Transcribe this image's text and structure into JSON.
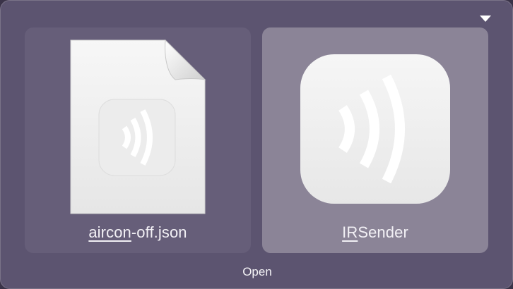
{
  "file_item": {
    "name_underlined": "aircon",
    "name_rest": "-off.json",
    "icon": "json-file-icon"
  },
  "app_item": {
    "name_underlined": "IR",
    "name_rest": "Sender",
    "icon": "irsender-app-icon",
    "selected": true
  },
  "open_button": {
    "label": "Open"
  },
  "options_menu": {
    "icon": "triangle-down-icon"
  },
  "colors": {
    "background": "#5c5470",
    "tile": "#665e79",
    "tile_selected": "#8b8497",
    "text": "#f2f0f5"
  }
}
